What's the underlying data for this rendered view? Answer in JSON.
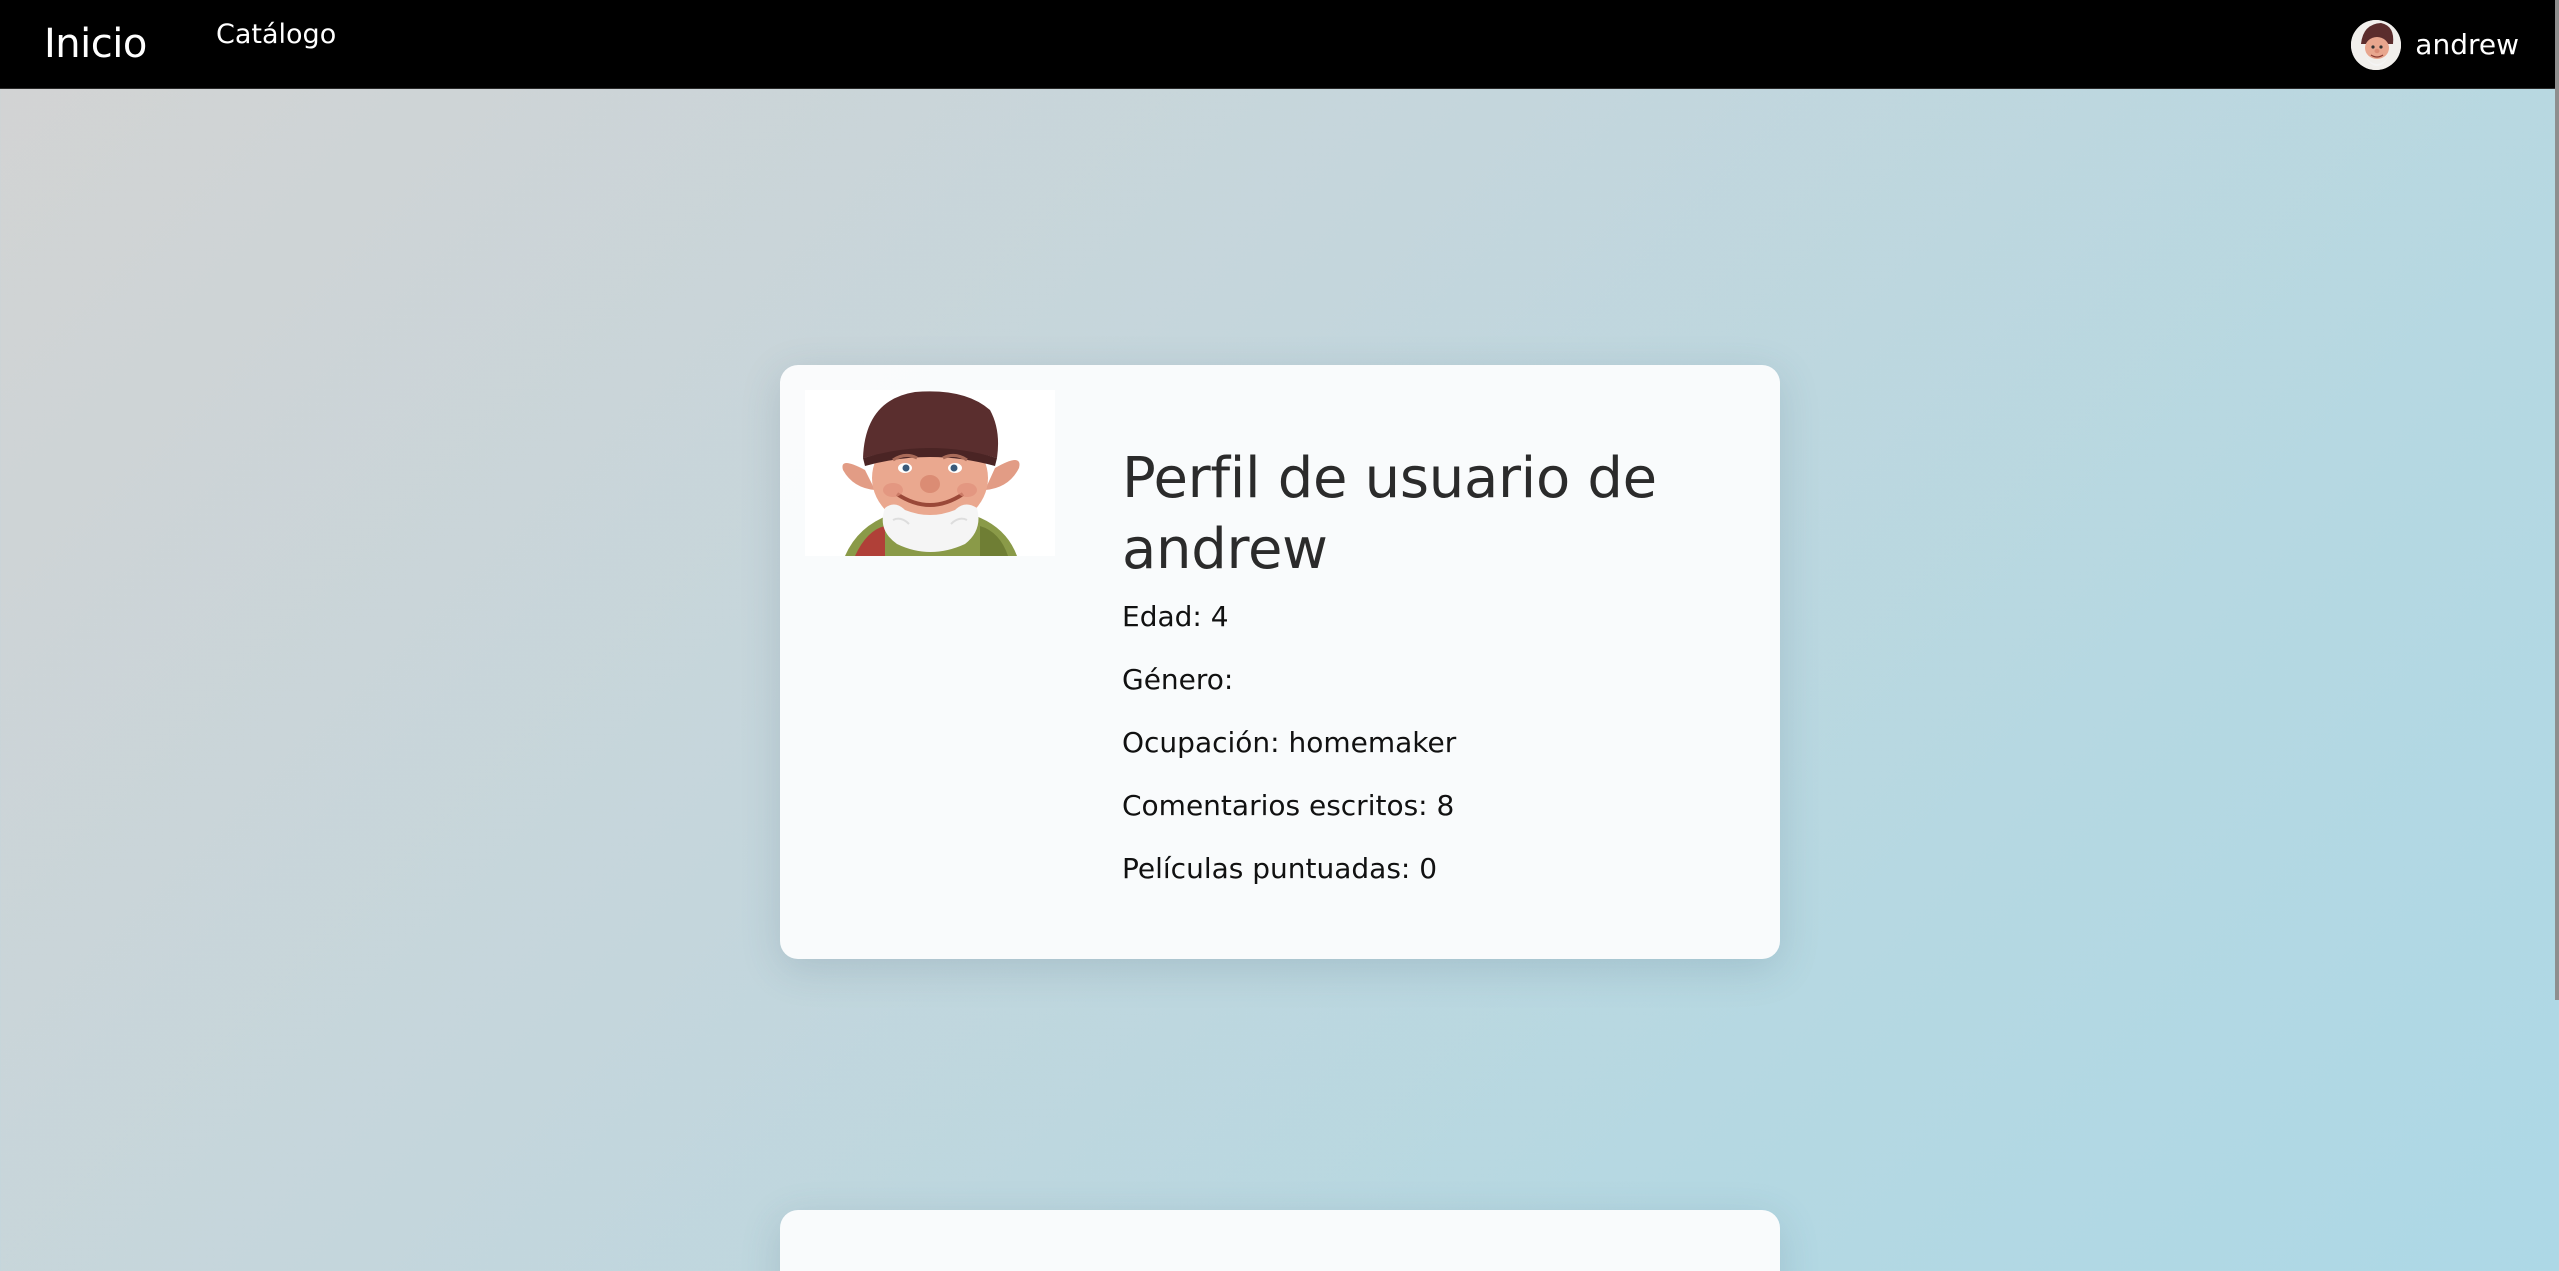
{
  "nav": {
    "brand": "Inicio",
    "links": [
      {
        "label": "Catálogo"
      }
    ],
    "user": {
      "username": "andrew"
    }
  },
  "profile": {
    "title": "Perfil de usuario de andrew",
    "stats": [
      {
        "text": "Edad: 4"
      },
      {
        "text": "Género:"
      },
      {
        "text": "Ocupación: homemaker"
      },
      {
        "text": "Comentarios escritos: 8"
      },
      {
        "text": "Películas puntuadas: 0"
      }
    ]
  },
  "colors": {
    "navbar": "#000000",
    "nav_text": "#ffffff",
    "card": "#fbfcfd",
    "bg_gradient_start": "#d3d3d3",
    "bg_gradient_end": "#add8e6"
  }
}
